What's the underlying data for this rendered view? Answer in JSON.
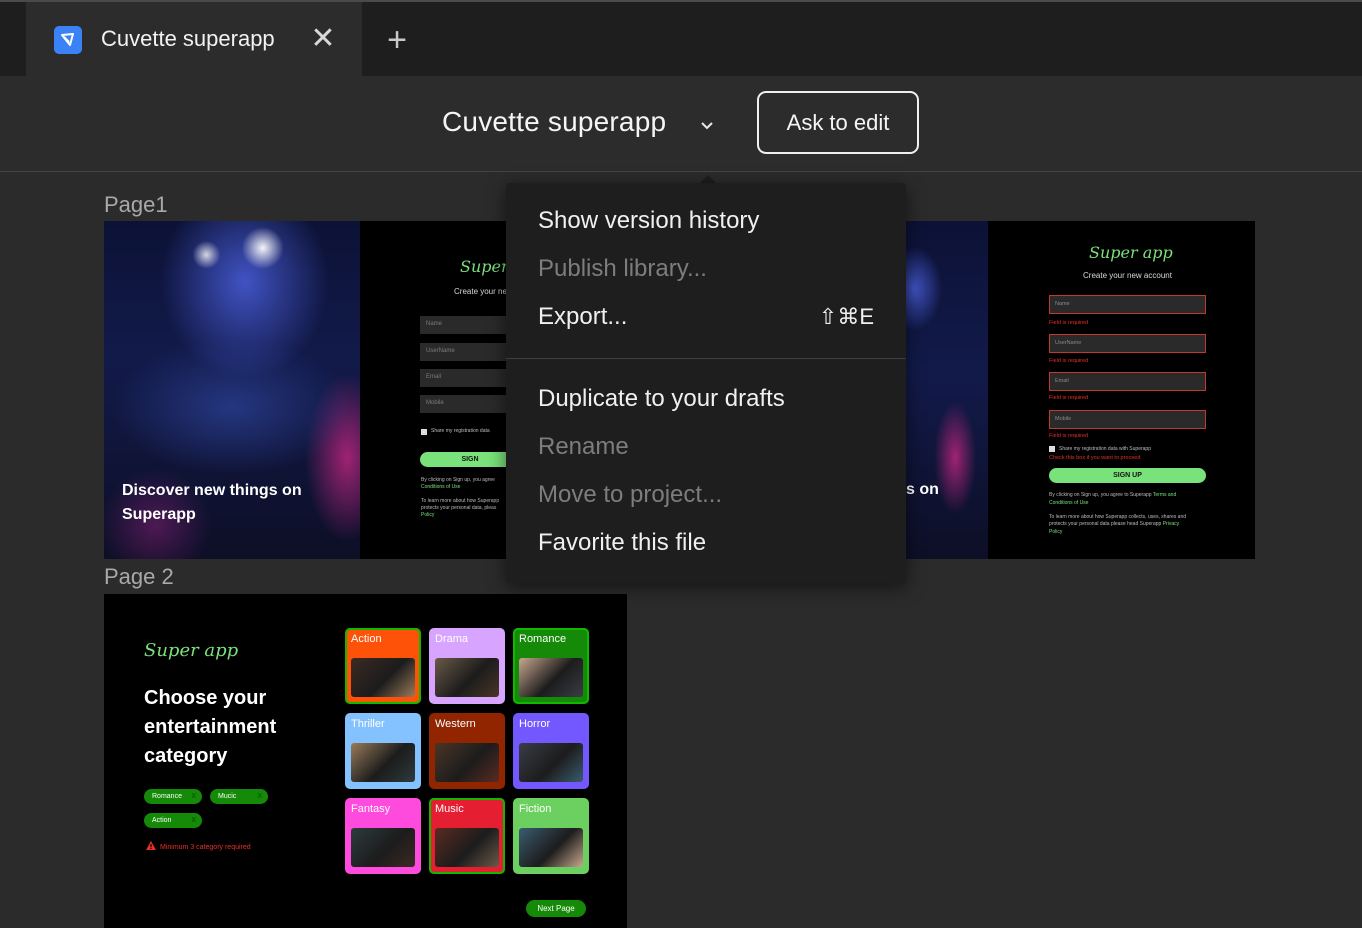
{
  "tab": {
    "title": "Cuvette superapp",
    "close_glyph": "✕",
    "new_tab_glyph": "+",
    "app_icon": "figma-file-icon"
  },
  "toolbar": {
    "file_title": "Cuvette superapp",
    "ask_to_edit": "Ask to edit"
  },
  "menu": {
    "items": [
      {
        "label": "Show version history",
        "enabled": true
      },
      {
        "label": "Publish library...",
        "enabled": false
      },
      {
        "label": "Export...",
        "enabled": true,
        "shortcut": "⇧⌘E"
      },
      {
        "label": "Duplicate to your drafts",
        "enabled": true
      },
      {
        "label": "Rename",
        "enabled": false
      },
      {
        "label": "Move to project...",
        "enabled": false
      },
      {
        "label": "Favorite this file",
        "enabled": true
      }
    ]
  },
  "canvas": {
    "page1_label": "Page1",
    "page2_label": "Page 2",
    "frame1": {
      "caption": "Discover new things on Superapp",
      "brand": "Super",
      "subtitle": "Create your ne",
      "inputs": [
        "Name",
        "UserName",
        "Email",
        "Mobile"
      ],
      "checkbox_label": "Share my registration data",
      "signup": "SIGN",
      "fine_1": "By clicking on Sign up, you agree",
      "fine_2": "Conditions of Use",
      "fine_3": "To learn more about how Superapp",
      "fine_4": "protects your personal data, pleas",
      "fine_5": "Policy"
    },
    "frame3": {
      "caption_fragment": "s on",
      "brand": "Super app",
      "subtitle": "Create your new account",
      "inputs": [
        "Name",
        "UserName",
        "Email",
        "Mobile"
      ],
      "error": "Field is required",
      "checkbox_label": "Share my registration data with Superapp",
      "checkbox_error": "Check this box if you want to proceed",
      "signup": "SIGN UP",
      "fine_1": "By clicking on Sign up, you agree to Superapp",
      "fine_1_link": "Terms and",
      "fine_2": "Conditions of Use",
      "fine_3": "To learn more about how Superapp collects, uses, shares and",
      "fine_4": "protects your personal data please head Superapp",
      "fine_4_link": "Privacy",
      "fine_5": "Policy"
    },
    "page2": {
      "brand": "Super app",
      "heading": "Choose your entertainment category",
      "chips": [
        {
          "label": "Romance",
          "x": "X"
        },
        {
          "label": "Mucic",
          "x": "X"
        },
        {
          "label": "Action",
          "x": "X"
        }
      ],
      "warning": "Minimum 3 category required",
      "next": "Next Page",
      "categories": [
        {
          "name": "Action",
          "color": "#ff5209",
          "selected": true
        },
        {
          "name": "Drama",
          "color": "#d7a4ff",
          "selected": false
        },
        {
          "name": "Romance",
          "color": "#148a08",
          "selected": true
        },
        {
          "name": "Thriller",
          "color": "#84c2ff",
          "selected": false
        },
        {
          "name": "Western",
          "color": "#902500",
          "selected": false
        },
        {
          "name": "Horror",
          "color": "#7358ff",
          "selected": false
        },
        {
          "name": "Fantasy",
          "color": "#ff4ade",
          "selected": false
        },
        {
          "name": "Music",
          "color": "#e61e32",
          "selected": true
        },
        {
          "name": "Fiction",
          "color": "#6cd061",
          "selected": false
        }
      ]
    }
  },
  "colors": {
    "accent_green": "#79e27a",
    "error_red": "#e5302a",
    "menu_bg": "#1e1e1e",
    "app_icon": "#3b82f6"
  }
}
